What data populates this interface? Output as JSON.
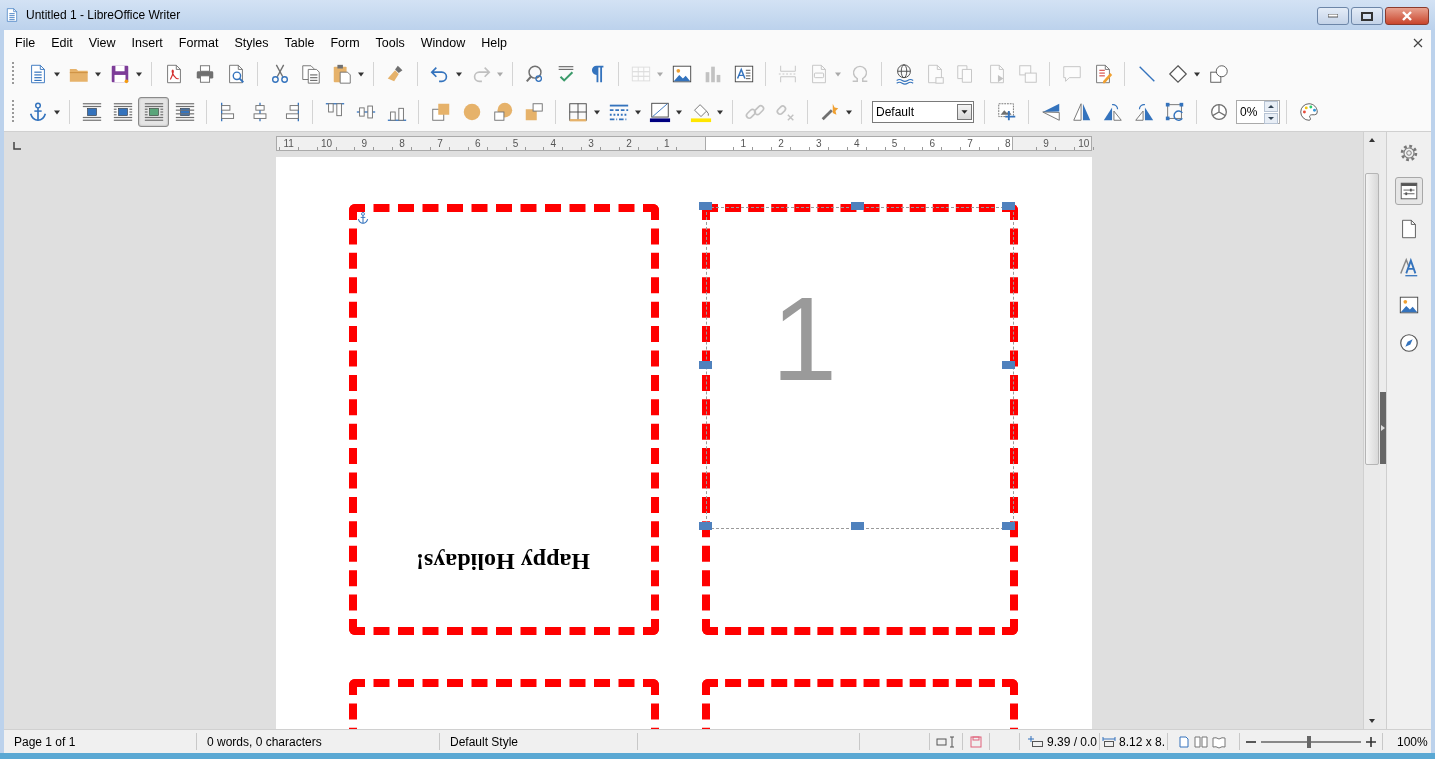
{
  "window": {
    "title": "Untitled 1 - LibreOffice Writer"
  },
  "menu_bar": [
    "File",
    "Edit",
    "View",
    "Insert",
    "Format",
    "Styles",
    "Table",
    "Form",
    "Tools",
    "Window",
    "Help"
  ],
  "toolbar_standard": {
    "groups": [
      {
        "items": [
          {
            "kind": "new-document",
            "dropdown": true,
            "disabled": false,
            "selected": false
          },
          {
            "kind": "open",
            "dropdown": true,
            "disabled": false,
            "selected": false
          },
          {
            "kind": "save",
            "dropdown": true,
            "disabled": false,
            "selected": false
          }
        ]
      },
      {
        "items": [
          {
            "kind": "export-pdf",
            "dropdown": false,
            "disabled": false,
            "selected": false
          },
          {
            "kind": "print",
            "dropdown": false,
            "disabled": false,
            "selected": false
          },
          {
            "kind": "print-preview",
            "dropdown": false,
            "disabled": false,
            "selected": false
          }
        ]
      },
      {
        "items": [
          {
            "kind": "cut",
            "dropdown": false,
            "disabled": false,
            "selected": false
          },
          {
            "kind": "copy",
            "dropdown": false,
            "disabled": false,
            "selected": false
          },
          {
            "kind": "paste",
            "dropdown": true,
            "disabled": false,
            "selected": false
          }
        ]
      },
      {
        "items": [
          {
            "kind": "clone",
            "dropdown": false,
            "disabled": false,
            "selected": false
          }
        ]
      },
      {
        "items": [
          {
            "kind": "undo",
            "dropdown": true,
            "disabled": false,
            "selected": false
          },
          {
            "kind": "redo",
            "dropdown": true,
            "disabled": true,
            "selected": false
          }
        ]
      },
      {
        "items": [
          {
            "kind": "find-replace",
            "dropdown": false,
            "disabled": false,
            "selected": false
          },
          {
            "kind": "spelling",
            "dropdown": false,
            "disabled": false,
            "selected": false
          },
          {
            "kind": "formatting-marks",
            "dropdown": false,
            "disabled": false,
            "selected": false
          }
        ]
      },
      {
        "items": [
          {
            "kind": "table",
            "dropdown": true,
            "disabled": true,
            "selected": false
          },
          {
            "kind": "image",
            "dropdown": false,
            "disabled": false,
            "selected": false
          },
          {
            "kind": "chart",
            "dropdown": false,
            "disabled": true,
            "selected": false
          },
          {
            "kind": "text-box",
            "dropdown": false,
            "disabled": false,
            "selected": false
          }
        ]
      },
      {
        "items": [
          {
            "kind": "page-break",
            "dropdown": false,
            "disabled": true,
            "selected": false
          },
          {
            "kind": "field",
            "dropdown": true,
            "disabled": true,
            "selected": false
          },
          {
            "kind": "special-char",
            "dropdown": false,
            "disabled": true,
            "selected": false
          }
        ]
      },
      {
        "items": [
          {
            "kind": "hyperlink",
            "dropdown": false,
            "disabled": false,
            "selected": false
          },
          {
            "kind": "footnote",
            "dropdown": false,
            "disabled": true,
            "selected": false
          },
          {
            "kind": "endnote",
            "dropdown": false,
            "disabled": true,
            "selected": false
          },
          {
            "kind": "bookmark",
            "dropdown": false,
            "disabled": true,
            "selected": false
          },
          {
            "kind": "cross-reference",
            "dropdown": false,
            "disabled": true,
            "selected": false
          }
        ]
      },
      {
        "items": [
          {
            "kind": "comment",
            "dropdown": false,
            "disabled": true,
            "selected": false
          },
          {
            "kind": "track-changes",
            "dropdown": false,
            "disabled": false,
            "selected": false
          }
        ]
      },
      {
        "items": [
          {
            "kind": "line",
            "dropdown": false,
            "disabled": false,
            "selected": false
          },
          {
            "kind": "shapes",
            "dropdown": true,
            "disabled": false,
            "selected": false
          },
          {
            "kind": "draw-functions",
            "dropdown": false,
            "disabled": false,
            "selected": false
          }
        ]
      }
    ]
  },
  "toolbar_frame": {
    "groups": [
      {
        "items": [
          {
            "kind": "anchor",
            "dropdown": true,
            "disabled": false,
            "selected": false
          }
        ]
      },
      {
        "items": [
          {
            "kind": "wrap-off",
            "dropdown": false,
            "disabled": false,
            "selected": false
          },
          {
            "kind": "wrap-page",
            "dropdown": false,
            "disabled": false,
            "selected": false
          },
          {
            "kind": "wrap-optimal",
            "dropdown": false,
            "disabled": false,
            "selected": true
          },
          {
            "kind": "wrap-through",
            "dropdown": false,
            "disabled": false,
            "selected": false
          }
        ]
      },
      {
        "items": [
          {
            "kind": "align-left",
            "dropdown": false,
            "disabled": false,
            "selected": false
          },
          {
            "kind": "align-center",
            "dropdown": false,
            "disabled": false,
            "selected": false
          },
          {
            "kind": "align-right",
            "dropdown": false,
            "disabled": false,
            "selected": false
          }
        ]
      },
      {
        "items": [
          {
            "kind": "align-top",
            "dropdown": false,
            "disabled": false,
            "selected": false
          },
          {
            "kind": "align-middle",
            "dropdown": false,
            "disabled": false,
            "selected": false
          },
          {
            "kind": "align-bottom",
            "dropdown": false,
            "disabled": false,
            "selected": false
          }
        ]
      },
      {
        "items": [
          {
            "kind": "bring-front",
            "dropdown": false,
            "disabled": false,
            "selected": false
          },
          {
            "kind": "forward",
            "dropdown": false,
            "disabled": false,
            "selected": false
          },
          {
            "kind": "backward",
            "dropdown": false,
            "disabled": false,
            "selected": false
          },
          {
            "kind": "send-back",
            "dropdown": false,
            "disabled": false,
            "selected": false
          }
        ]
      },
      {
        "items": [
          {
            "kind": "borders",
            "dropdown": true,
            "disabled": false,
            "selected": false
          },
          {
            "kind": "border-style",
            "dropdown": true,
            "disabled": false,
            "selected": false
          },
          {
            "kind": "border-color",
            "dropdown": true,
            "disabled": false,
            "selected": false
          },
          {
            "kind": "area-fill",
            "dropdown": true,
            "disabled": false,
            "selected": false
          }
        ]
      },
      {
        "items": [
          {
            "kind": "link-frames",
            "dropdown": false,
            "disabled": true,
            "selected": false
          },
          {
            "kind": "unlink-frames",
            "dropdown": false,
            "disabled": true,
            "selected": false
          }
        ]
      },
      {
        "items": [
          {
            "kind": "extrusion",
            "dropdown": true,
            "disabled": false,
            "selected": false
          }
        ]
      },
      {
        "items": [
          {
            "kind": "style-combo",
            "value": "Default",
            "dropdown": true,
            "disabled": false,
            "selected": false
          }
        ]
      },
      {
        "items": [
          {
            "kind": "crop",
            "dropdown": false,
            "disabled": false,
            "selected": false
          }
        ]
      },
      {
        "items": [
          {
            "kind": "flip-vertical",
            "dropdown": false,
            "disabled": false,
            "selected": false
          },
          {
            "kind": "flip-horizontal",
            "dropdown": false,
            "disabled": false,
            "selected": false
          },
          {
            "kind": "rotate-left",
            "dropdown": false,
            "disabled": false,
            "selected": false
          },
          {
            "kind": "rotate-right",
            "dropdown": false,
            "disabled": false,
            "selected": false
          },
          {
            "kind": "rotate-mode",
            "dropdown": false,
            "disabled": false,
            "selected": false
          }
        ]
      },
      {
        "items": [
          {
            "kind": "transparency",
            "dropdown": false,
            "disabled": false,
            "selected": false
          },
          {
            "kind": "spin",
            "value": "0%",
            "dropdown": false,
            "disabled": false,
            "selected": false
          }
        ]
      },
      {
        "items": [
          {
            "kind": "palette",
            "dropdown": false,
            "disabled": false,
            "selected": false
          }
        ]
      }
    ]
  },
  "ruler": {
    "left_labels": [
      "11",
      "10",
      "9",
      "8",
      "7",
      "6",
      "5",
      "4",
      "3",
      "2",
      "1"
    ],
    "body_labels": [
      "1",
      "2",
      "3",
      "4",
      "5",
      "6",
      "7",
      "8"
    ],
    "right_labels": [
      "9",
      "10"
    ]
  },
  "document": {
    "cards": [
      {
        "kind": "greeting",
        "text": "Happy Holidays!",
        "selected": false
      },
      {
        "kind": "number",
        "text": "1",
        "selected": true
      },
      {
        "kind": "blank",
        "selected": false
      },
      {
        "kind": "blank",
        "selected": false
      }
    ]
  },
  "sidebar": {
    "items": [
      {
        "kind": "settings",
        "selected": false
      },
      {
        "kind": "properties",
        "selected": true
      },
      {
        "kind": "page",
        "selected": false
      },
      {
        "kind": "styles",
        "selected": false
      },
      {
        "kind": "gallery",
        "selected": false
      },
      {
        "kind": "navigator",
        "selected": false
      }
    ]
  },
  "status_bar": {
    "page": "Page 1 of 1",
    "word_count": "0 words, 0 characters",
    "page_style": "Default Style",
    "modified": true,
    "position": "9.39 / 0.0",
    "size": "8.12 x 8.",
    "view_layouts": [
      {
        "kind": "single",
        "selected": true
      },
      {
        "kind": "multi",
        "selected": false
      },
      {
        "kind": "book",
        "selected": false
      }
    ],
    "zoom_slider": {
      "level": 0.48
    },
    "zoom": "100%"
  }
}
